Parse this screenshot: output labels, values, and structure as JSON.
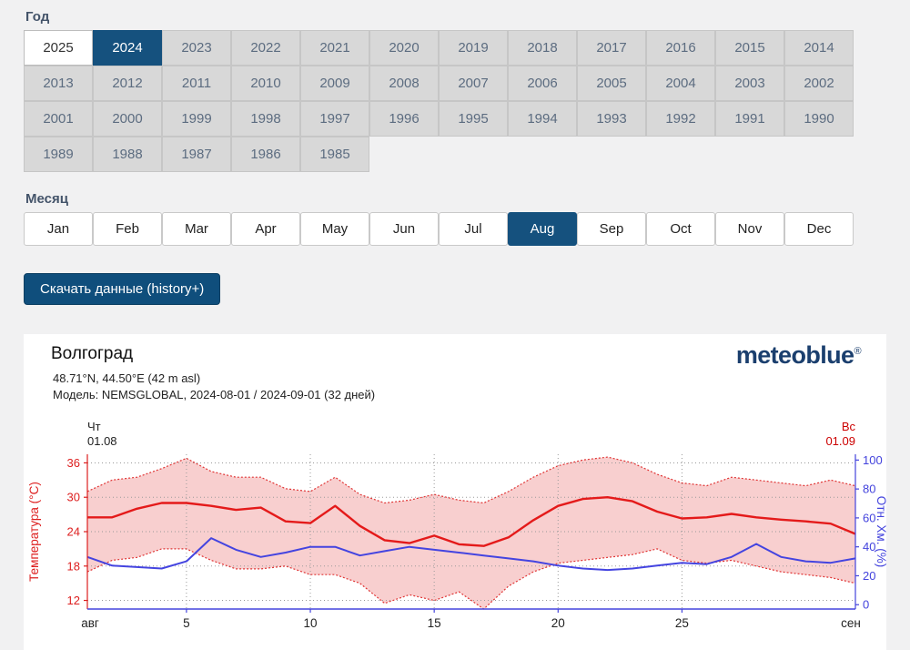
{
  "year_section": {
    "label": "Год",
    "years": [
      {
        "value": "2025",
        "state": "available"
      },
      {
        "value": "2024",
        "state": "selected"
      },
      {
        "value": "2023",
        "state": "default"
      },
      {
        "value": "2022",
        "state": "default"
      },
      {
        "value": "2021",
        "state": "default"
      },
      {
        "value": "2020",
        "state": "default"
      },
      {
        "value": "2019",
        "state": "default"
      },
      {
        "value": "2018",
        "state": "default"
      },
      {
        "value": "2017",
        "state": "default"
      },
      {
        "value": "2016",
        "state": "default"
      },
      {
        "value": "2015",
        "state": "default"
      },
      {
        "value": "2014",
        "state": "default"
      },
      {
        "value": "2013",
        "state": "default"
      },
      {
        "value": "2012",
        "state": "default"
      },
      {
        "value": "2011",
        "state": "default"
      },
      {
        "value": "2010",
        "state": "default"
      },
      {
        "value": "2009",
        "state": "default"
      },
      {
        "value": "2008",
        "state": "default"
      },
      {
        "value": "2007",
        "state": "default"
      },
      {
        "value": "2006",
        "state": "default"
      },
      {
        "value": "2005",
        "state": "default"
      },
      {
        "value": "2004",
        "state": "default"
      },
      {
        "value": "2003",
        "state": "default"
      },
      {
        "value": "2002",
        "state": "default"
      },
      {
        "value": "2001",
        "state": "default"
      },
      {
        "value": "2000",
        "state": "default"
      },
      {
        "value": "1999",
        "state": "default"
      },
      {
        "value": "1998",
        "state": "default"
      },
      {
        "value": "1997",
        "state": "default"
      },
      {
        "value": "1996",
        "state": "default"
      },
      {
        "value": "1995",
        "state": "default"
      },
      {
        "value": "1994",
        "state": "default"
      },
      {
        "value": "1993",
        "state": "default"
      },
      {
        "value": "1992",
        "state": "default"
      },
      {
        "value": "1991",
        "state": "default"
      },
      {
        "value": "1990",
        "state": "default"
      },
      {
        "value": "1989",
        "state": "default"
      },
      {
        "value": "1988",
        "state": "default"
      },
      {
        "value": "1987",
        "state": "default"
      },
      {
        "value": "1986",
        "state": "default"
      },
      {
        "value": "1985",
        "state": "default"
      }
    ]
  },
  "month_section": {
    "label": "Месяц",
    "months": [
      {
        "label": "Jan",
        "state": "default"
      },
      {
        "label": "Feb",
        "state": "default"
      },
      {
        "label": "Mar",
        "state": "default"
      },
      {
        "label": "Apr",
        "state": "default"
      },
      {
        "label": "May",
        "state": "default"
      },
      {
        "label": "Jun",
        "state": "default"
      },
      {
        "label": "Jul",
        "state": "default"
      },
      {
        "label": "Aug",
        "state": "selected"
      },
      {
        "label": "Sep",
        "state": "default"
      },
      {
        "label": "Oct",
        "state": "default"
      },
      {
        "label": "Nov",
        "state": "default"
      },
      {
        "label": "Dec",
        "state": "default"
      }
    ]
  },
  "download_button": {
    "label": "Скачать данные (history+)"
  },
  "colors": {
    "accent": "#15517e",
    "temperature": "#e41a1a",
    "humidity": "#4444e0",
    "band_fill": "#f8cfcf",
    "weekend_red": "#cc0000",
    "brand_navy": "#1b3f6e"
  },
  "chart": {
    "title": "Волгоград",
    "coords": "48.71°N, 44.50°E (42 m asl)",
    "model_line": "Модель: NEMSGLOBAL, 2024-08-01 / 2024-09-01 (32 дней)",
    "brand": "meteoblue",
    "brand_reg": "®",
    "start_day_label": {
      "weekday": "Чт",
      "date": "01.08"
    },
    "end_day_label": {
      "weekday": "Вс",
      "date": "01.09"
    },
    "chart_data": {
      "type": "line",
      "title": "Волгоград — NEMSGLOBAL 2024-08-01 / 2024-09-01 (32 дней)",
      "x_unit": "day of period (Aug 1 = 1, Sep 1 = 32)",
      "x_days": 32,
      "x_tick_days": [
        5,
        10,
        15,
        20,
        25
      ],
      "x_label_start": "авг",
      "x_label_end": "сен",
      "grid": true,
      "left_axis": {
        "label": "Температура (°C)",
        "min": 10.5,
        "max": 37.5,
        "ticks": [
          12,
          18,
          24,
          30,
          36
        ],
        "color": "#dd1f1f"
      },
      "right_axis": {
        "label": "Отн. Хм. (%)",
        "min": -3,
        "max": 104,
        "ticks": [
          0,
          20,
          40,
          60,
          80,
          100
        ],
        "color": "#4343dd"
      },
      "band": {
        "upper": "temperature_max",
        "lower": "temperature_min",
        "fill": "#f8cfcf"
      },
      "series": [
        {
          "name": "temperature_mean",
          "unit": "°C",
          "axis": "left",
          "color": "#e41a1a",
          "style": "solid",
          "values": [
            26.5,
            26.5,
            28,
            29,
            29,
            28.5,
            27.8,
            28.2,
            25.8,
            25.5,
            28.5,
            25,
            22.5,
            22,
            23.3,
            21.8,
            21.5,
            23,
            26,
            28.5,
            29.7,
            30,
            29.3,
            27.5,
            26.3,
            26.5,
            27.1,
            26.5,
            26.1,
            25.8,
            25.4,
            23.6
          ]
        },
        {
          "name": "temperature_max",
          "unit": "°C",
          "axis": "left",
          "color": "#e03535",
          "style": "dotted",
          "values": [
            31,
            33,
            33.5,
            35,
            36.8,
            34.5,
            33.5,
            33.5,
            31.5,
            31,
            33.5,
            30.5,
            29,
            29.5,
            30.5,
            29.5,
            29,
            31,
            33.5,
            35.5,
            36.5,
            37,
            36,
            34,
            32.5,
            32,
            33.5,
            33,
            32.5,
            32,
            33,
            32
          ]
        },
        {
          "name": "temperature_min",
          "unit": "°C",
          "axis": "left",
          "color": "#e03535",
          "style": "dotted",
          "values": [
            17,
            19,
            19.5,
            21,
            21,
            19,
            17.5,
            17.5,
            18,
            16.5,
            16.5,
            15,
            11.5,
            13,
            12,
            13.5,
            10.5,
            14.5,
            17,
            18.5,
            19,
            19.5,
            20,
            21,
            19,
            18.5,
            19,
            18,
            17,
            16.5,
            16,
            15
          ]
        },
        {
          "name": "relative_humidity",
          "unit": "%",
          "axis": "right",
          "color": "#4444e0",
          "style": "solid",
          "values": [
            33,
            27,
            26,
            25,
            30,
            46,
            38,
            33,
            36,
            40,
            40,
            34,
            37,
            40,
            38,
            36,
            34,
            32,
            30,
            27,
            25,
            24,
            25,
            27,
            29,
            28,
            33,
            42,
            33,
            30,
            29,
            32
          ]
        }
      ]
    }
  }
}
